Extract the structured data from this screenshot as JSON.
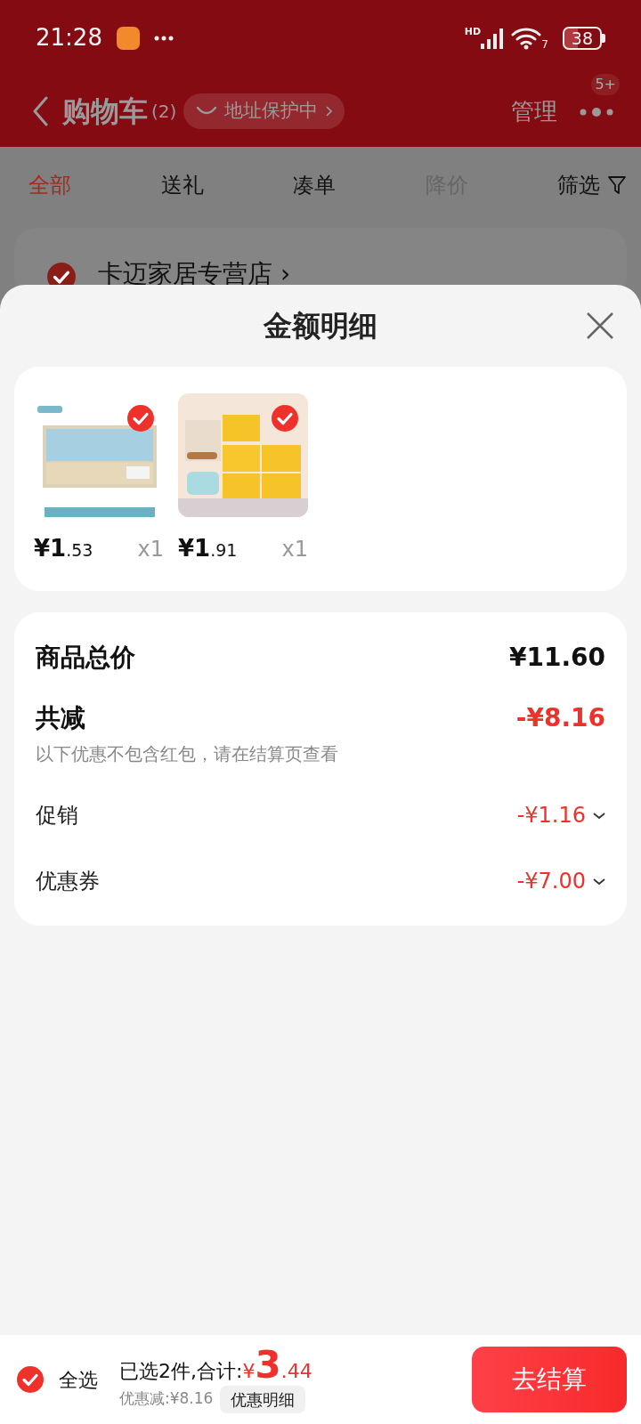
{
  "status_bar": {
    "time": "21:28",
    "signal_label": "HD",
    "wifi_label": "7",
    "battery": "38"
  },
  "header": {
    "title": "购物车",
    "count": "(2)",
    "address_badge": "地址保护中",
    "manage": "管理",
    "more_badge": "5+"
  },
  "tabs": [
    {
      "label": "全部",
      "selected": true,
      "disabled": false
    },
    {
      "label": "送礼",
      "selected": false,
      "disabled": false
    },
    {
      "label": "凑单",
      "selected": false,
      "disabled": false
    },
    {
      "label": "降价",
      "selected": false,
      "disabled": true
    }
  ],
  "filter": "筛选",
  "store": {
    "name": "卡迈家居专营店 ›",
    "checked": true
  },
  "sheet": {
    "title": "金额明细",
    "items": [
      {
        "kind": "picture",
        "checked": true,
        "price": "¥1",
        "price_fraction": ".53",
        "quantity": "x1"
      },
      {
        "kind": "picture",
        "checked": true,
        "price": "¥1",
        "price_fraction": ".91",
        "quantity": "x1"
      }
    ],
    "summary": {
      "total_label": "商品总价",
      "total": "¥11.60",
      "discount_label": "共减",
      "discount": "-¥8.16",
      "note": "以下优惠不包含红包，请在结算页查看",
      "rows": [
        {
          "label": "促销",
          "value": "-¥1.16"
        },
        {
          "label": "优惠券",
          "value": "-¥7.00"
        }
      ]
    }
  },
  "footer": {
    "select_all": {
      "label": "全选",
      "checked": true
    },
    "selected_text": "已选2件,合计:",
    "currency": "¥",
    "total": "3",
    "total_fraction": ".44",
    "saving": "优惠减:¥8.16",
    "detail_button": "优惠明细",
    "checkout": "去结算"
  }
}
